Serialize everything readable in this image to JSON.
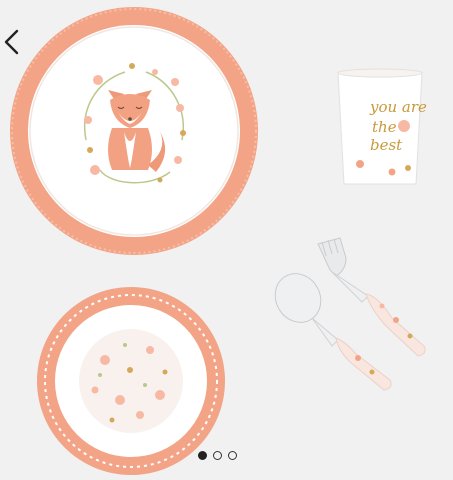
{
  "nav": {
    "back_icon": "chevron-left-icon"
  },
  "product": {
    "items": [
      "plate",
      "cup",
      "fork",
      "spoon",
      "bowl"
    ],
    "cup_text": {
      "line1": "you are",
      "line2": "the",
      "line3": "best"
    }
  },
  "pager": {
    "total": 3,
    "active_index": 0
  },
  "colors": {
    "background": "#f1f1f1",
    "rim": "#f2a488",
    "fox": "#ee9a78",
    "gold": "#c99a3a",
    "white": "#ffffff"
  }
}
